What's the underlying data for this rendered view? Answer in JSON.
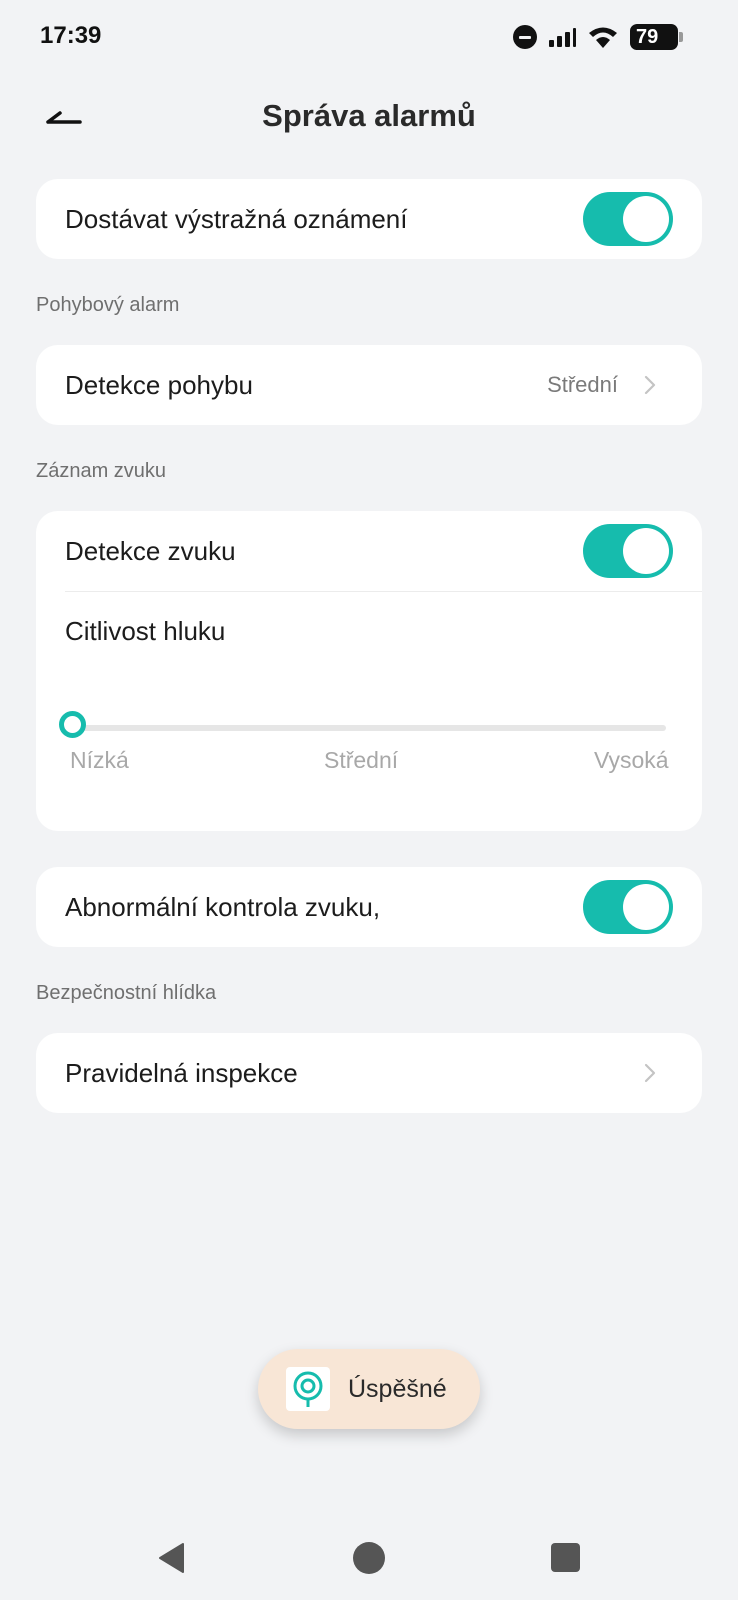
{
  "status_bar": {
    "time": "17:39",
    "battery": "79",
    "icons": [
      "do-not-disturb-icon",
      "signal-icon",
      "wifi-icon",
      "battery-icon"
    ]
  },
  "header": {
    "title": "Správa alarmů",
    "back_icon": "back-arrow-icon"
  },
  "notifications": {
    "label": "Dostávat výstražná oznámení",
    "enabled": true
  },
  "motion_section": {
    "title": "Pohybový alarm",
    "detection_label": "Detekce pohybu",
    "detection_value": "Střední"
  },
  "sound_section": {
    "title": "Záznam zvuku",
    "detection_label": "Detekce zvuku",
    "detection_enabled": true,
    "sensitivity_label": "Citlivost hluku",
    "sensitivity_levels": [
      "Nízká",
      "Střední",
      "Vysoká"
    ],
    "sensitivity_selected": "Nízká",
    "sensitivity_fraction": 0
  },
  "abnormal_sound": {
    "label": "Abnormální kontrola zvuku,",
    "enabled": true
  },
  "security_section": {
    "title": "Bezpečnostní hlídka",
    "inspection_label": "Pravidelná inspekce"
  },
  "toast": {
    "text": "Úspěšné",
    "icon": "app-logo-icon"
  },
  "nav_bar": {
    "icons": [
      "nav-back-icon",
      "nav-home-icon",
      "nav-recents-icon"
    ]
  },
  "colors": {
    "accent": "#16bcad",
    "background": "#f2f3f5",
    "card": "#ffffff",
    "toast_background": "#f8e6d6"
  }
}
